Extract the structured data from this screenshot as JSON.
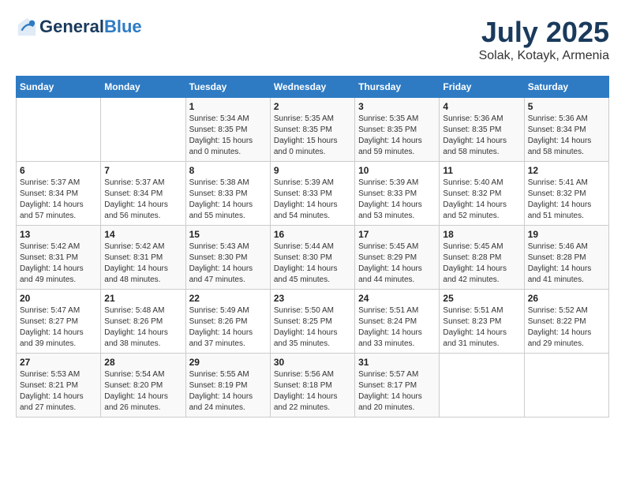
{
  "header": {
    "logo_line1": "General",
    "logo_line2": "Blue",
    "main_title": "July 2025",
    "subtitle": "Solak, Kotayk, Armenia"
  },
  "calendar": {
    "days_of_week": [
      "Sunday",
      "Monday",
      "Tuesday",
      "Wednesday",
      "Thursday",
      "Friday",
      "Saturday"
    ],
    "weeks": [
      [
        {
          "day": "",
          "info": ""
        },
        {
          "day": "",
          "info": ""
        },
        {
          "day": "1",
          "info": "Sunrise: 5:34 AM\nSunset: 8:35 PM\nDaylight: 15 hours\nand 0 minutes."
        },
        {
          "day": "2",
          "info": "Sunrise: 5:35 AM\nSunset: 8:35 PM\nDaylight: 15 hours\nand 0 minutes."
        },
        {
          "day": "3",
          "info": "Sunrise: 5:35 AM\nSunset: 8:35 PM\nDaylight: 14 hours\nand 59 minutes."
        },
        {
          "day": "4",
          "info": "Sunrise: 5:36 AM\nSunset: 8:35 PM\nDaylight: 14 hours\nand 58 minutes."
        },
        {
          "day": "5",
          "info": "Sunrise: 5:36 AM\nSunset: 8:34 PM\nDaylight: 14 hours\nand 58 minutes."
        }
      ],
      [
        {
          "day": "6",
          "info": "Sunrise: 5:37 AM\nSunset: 8:34 PM\nDaylight: 14 hours\nand 57 minutes."
        },
        {
          "day": "7",
          "info": "Sunrise: 5:37 AM\nSunset: 8:34 PM\nDaylight: 14 hours\nand 56 minutes."
        },
        {
          "day": "8",
          "info": "Sunrise: 5:38 AM\nSunset: 8:33 PM\nDaylight: 14 hours\nand 55 minutes."
        },
        {
          "day": "9",
          "info": "Sunrise: 5:39 AM\nSunset: 8:33 PM\nDaylight: 14 hours\nand 54 minutes."
        },
        {
          "day": "10",
          "info": "Sunrise: 5:39 AM\nSunset: 8:33 PM\nDaylight: 14 hours\nand 53 minutes."
        },
        {
          "day": "11",
          "info": "Sunrise: 5:40 AM\nSunset: 8:32 PM\nDaylight: 14 hours\nand 52 minutes."
        },
        {
          "day": "12",
          "info": "Sunrise: 5:41 AM\nSunset: 8:32 PM\nDaylight: 14 hours\nand 51 minutes."
        }
      ],
      [
        {
          "day": "13",
          "info": "Sunrise: 5:42 AM\nSunset: 8:31 PM\nDaylight: 14 hours\nand 49 minutes."
        },
        {
          "day": "14",
          "info": "Sunrise: 5:42 AM\nSunset: 8:31 PM\nDaylight: 14 hours\nand 48 minutes."
        },
        {
          "day": "15",
          "info": "Sunrise: 5:43 AM\nSunset: 8:30 PM\nDaylight: 14 hours\nand 47 minutes."
        },
        {
          "day": "16",
          "info": "Sunrise: 5:44 AM\nSunset: 8:30 PM\nDaylight: 14 hours\nand 45 minutes."
        },
        {
          "day": "17",
          "info": "Sunrise: 5:45 AM\nSunset: 8:29 PM\nDaylight: 14 hours\nand 44 minutes."
        },
        {
          "day": "18",
          "info": "Sunrise: 5:45 AM\nSunset: 8:28 PM\nDaylight: 14 hours\nand 42 minutes."
        },
        {
          "day": "19",
          "info": "Sunrise: 5:46 AM\nSunset: 8:28 PM\nDaylight: 14 hours\nand 41 minutes."
        }
      ],
      [
        {
          "day": "20",
          "info": "Sunrise: 5:47 AM\nSunset: 8:27 PM\nDaylight: 14 hours\nand 39 minutes."
        },
        {
          "day": "21",
          "info": "Sunrise: 5:48 AM\nSunset: 8:26 PM\nDaylight: 14 hours\nand 38 minutes."
        },
        {
          "day": "22",
          "info": "Sunrise: 5:49 AM\nSunset: 8:26 PM\nDaylight: 14 hours\nand 37 minutes."
        },
        {
          "day": "23",
          "info": "Sunrise: 5:50 AM\nSunset: 8:25 PM\nDaylight: 14 hours\nand 35 minutes."
        },
        {
          "day": "24",
          "info": "Sunrise: 5:51 AM\nSunset: 8:24 PM\nDaylight: 14 hours\nand 33 minutes."
        },
        {
          "day": "25",
          "info": "Sunrise: 5:51 AM\nSunset: 8:23 PM\nDaylight: 14 hours\nand 31 minutes."
        },
        {
          "day": "26",
          "info": "Sunrise: 5:52 AM\nSunset: 8:22 PM\nDaylight: 14 hours\nand 29 minutes."
        }
      ],
      [
        {
          "day": "27",
          "info": "Sunrise: 5:53 AM\nSunset: 8:21 PM\nDaylight: 14 hours\nand 27 minutes."
        },
        {
          "day": "28",
          "info": "Sunrise: 5:54 AM\nSunset: 8:20 PM\nDaylight: 14 hours\nand 26 minutes."
        },
        {
          "day": "29",
          "info": "Sunrise: 5:55 AM\nSunset: 8:19 PM\nDaylight: 14 hours\nand 24 minutes."
        },
        {
          "day": "30",
          "info": "Sunrise: 5:56 AM\nSunset: 8:18 PM\nDaylight: 14 hours\nand 22 minutes."
        },
        {
          "day": "31",
          "info": "Sunrise: 5:57 AM\nSunset: 8:17 PM\nDaylight: 14 hours\nand 20 minutes."
        },
        {
          "day": "",
          "info": ""
        },
        {
          "day": "",
          "info": ""
        }
      ]
    ]
  }
}
